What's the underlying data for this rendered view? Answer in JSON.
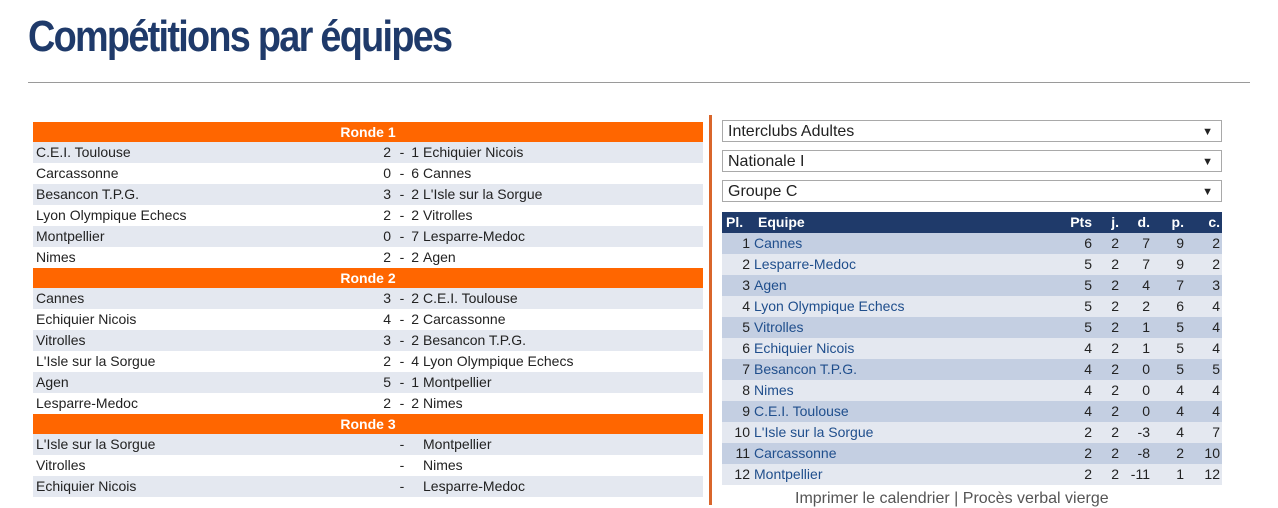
{
  "page_title": "Compétitions par équipes",
  "rounds": [
    {
      "label": "Ronde 1",
      "matches": [
        {
          "home": "C.E.I. Toulouse",
          "score_home": "2",
          "score_away": "1",
          "away": "Echiquier Nicois"
        },
        {
          "home": "Carcassonne",
          "score_home": "0",
          "score_away": "6",
          "away": "Cannes"
        },
        {
          "home": "Besancon T.P.G.",
          "score_home": "3",
          "score_away": "2",
          "away": "L'Isle sur la Sorgue"
        },
        {
          "home": "Lyon Olympique Echecs",
          "score_home": "2",
          "score_away": "2",
          "away": "Vitrolles"
        },
        {
          "home": "Montpellier",
          "score_home": "0",
          "score_away": "7",
          "away": "Lesparre-Medoc"
        },
        {
          "home": "Nimes",
          "score_home": "2",
          "score_away": "2",
          "away": "Agen"
        }
      ]
    },
    {
      "label": "Ronde 2",
      "matches": [
        {
          "home": "Cannes",
          "score_home": "3",
          "score_away": "2",
          "away": "C.E.I. Toulouse"
        },
        {
          "home": "Echiquier Nicois",
          "score_home": "4",
          "score_away": "2",
          "away": "Carcassonne"
        },
        {
          "home": "Vitrolles",
          "score_home": "3",
          "score_away": "2",
          "away": "Besancon T.P.G."
        },
        {
          "home": "L'Isle sur la Sorgue",
          "score_home": "2",
          "score_away": "4",
          "away": "Lyon Olympique Echecs"
        },
        {
          "home": "Agen",
          "score_home": "5",
          "score_away": "1",
          "away": "Montpellier"
        },
        {
          "home": "Lesparre-Medoc",
          "score_home": "2",
          "score_away": "2",
          "away": "Nimes"
        }
      ]
    },
    {
      "label": "Ronde 3",
      "matches": [
        {
          "home": "L'Isle sur la Sorgue",
          "score_home": "",
          "score_away": "",
          "away": "Montpellier"
        },
        {
          "home": "Vitrolles",
          "score_home": "",
          "score_away": "",
          "away": "Nimes"
        },
        {
          "home": "Echiquier Nicois",
          "score_home": "",
          "score_away": "",
          "away": "Lesparre-Medoc"
        }
      ]
    }
  ],
  "selects": {
    "competition": "Interclubs Adultes",
    "division": "Nationale I",
    "group": "Groupe C",
    "arrow": "▼"
  },
  "standings": {
    "headers": {
      "pl": "Pl.",
      "team": "Equipe",
      "pts": "Pts",
      "j": "j.",
      "d": "d.",
      "p": "p.",
      "c": "c."
    },
    "rows": [
      {
        "pl": "1",
        "team": "Cannes",
        "pts": "6",
        "j": "2",
        "d": "7",
        "p": "9",
        "c": "2"
      },
      {
        "pl": "2",
        "team": "Lesparre-Medoc",
        "pts": "5",
        "j": "2",
        "d": "7",
        "p": "9",
        "c": "2"
      },
      {
        "pl": "3",
        "team": "Agen",
        "pts": "5",
        "j": "2",
        "d": "4",
        "p": "7",
        "c": "3"
      },
      {
        "pl": "4",
        "team": "Lyon Olympique Echecs",
        "pts": "5",
        "j": "2",
        "d": "2",
        "p": "6",
        "c": "4"
      },
      {
        "pl": "5",
        "team": "Vitrolles",
        "pts": "5",
        "j": "2",
        "d": "1",
        "p": "5",
        "c": "4"
      },
      {
        "pl": "6",
        "team": "Echiquier Nicois",
        "pts": "4",
        "j": "2",
        "d": "1",
        "p": "5",
        "c": "4"
      },
      {
        "pl": "7",
        "team": "Besancon T.P.G.",
        "pts": "4",
        "j": "2",
        "d": "0",
        "p": "5",
        "c": "5"
      },
      {
        "pl": "8",
        "team": "Nimes",
        "pts": "4",
        "j": "2",
        "d": "0",
        "p": "4",
        "c": "4"
      },
      {
        "pl": "9",
        "team": "C.E.I. Toulouse",
        "pts": "4",
        "j": "2",
        "d": "0",
        "p": "4",
        "c": "4"
      },
      {
        "pl": "10",
        "team": "L'Isle sur la Sorgue",
        "pts": "2",
        "j": "2",
        "d": "-3",
        "p": "4",
        "c": "7"
      },
      {
        "pl": "11",
        "team": "Carcassonne",
        "pts": "2",
        "j": "2",
        "d": "-8",
        "p": "2",
        "c": "10"
      },
      {
        "pl": "12",
        "team": "Montpellier",
        "pts": "2",
        "j": "2",
        "d": "-11",
        "p": "1",
        "c": "12"
      }
    ]
  },
  "footer": {
    "print_calendar": "Imprimer le calendrier",
    "separator": "|",
    "blank_report": "Procès verbal vierge"
  },
  "colors": {
    "title": "#1f3a6a",
    "round_header": "#ff6600",
    "table_header": "#1f3a6a",
    "team_link": "#1f4e8c",
    "divider": "#d9662b"
  }
}
